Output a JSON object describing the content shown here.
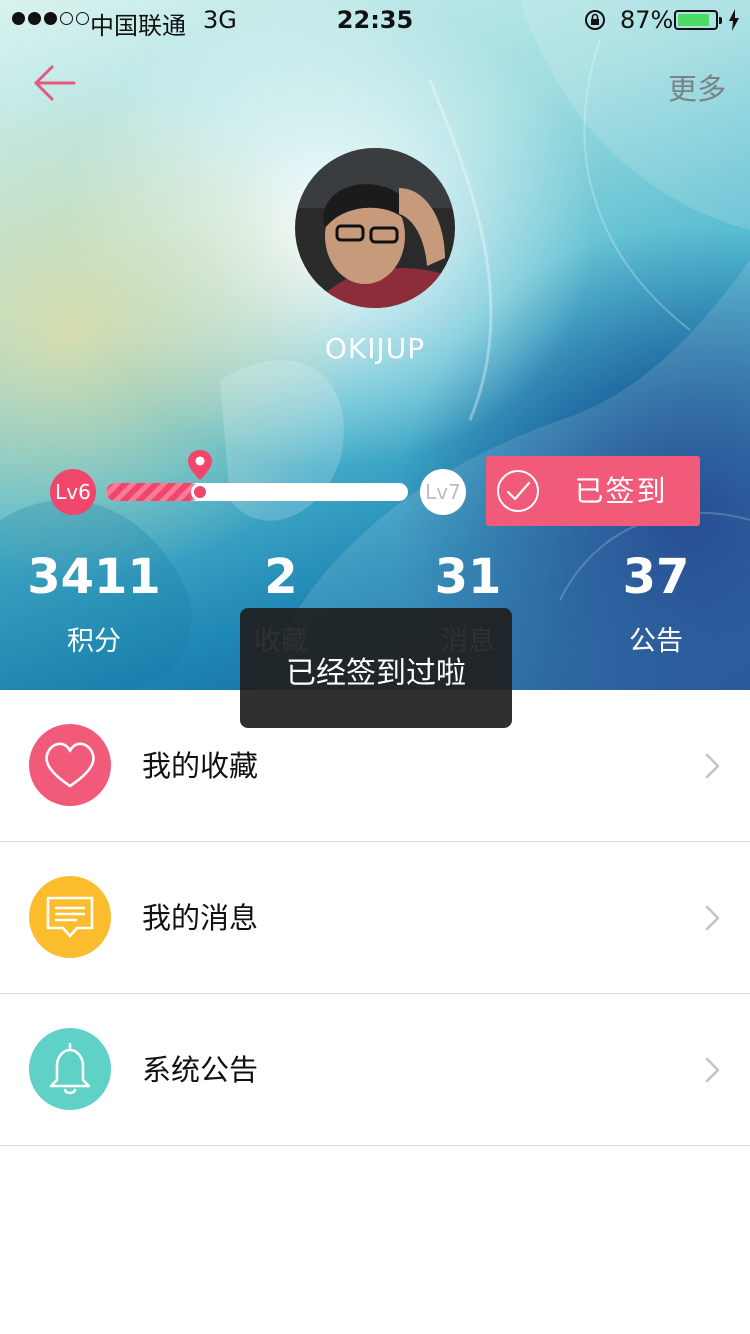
{
  "status_bar": {
    "carrier": "中国联通",
    "network": "3G",
    "time": "22:35",
    "battery_percent": "87%",
    "battery_level": 0.87,
    "signal_bars": 3
  },
  "nav": {
    "back_icon": "arrow-left-icon",
    "more_label": "更多"
  },
  "profile": {
    "username": "OKIJUP"
  },
  "level": {
    "current": "Lv6",
    "next": "Lv7",
    "progress": 0.31
  },
  "checkin": {
    "label": "已签到",
    "icon": "check-circle-icon"
  },
  "stats": [
    {
      "value": "3411",
      "label": "积分"
    },
    {
      "value": "2",
      "label": "收藏"
    },
    {
      "value": "31",
      "label": "消息"
    },
    {
      "value": "37",
      "label": "公告"
    }
  ],
  "menu": [
    {
      "label": "我的收藏",
      "icon": "heart-icon",
      "color": "#f25a7a"
    },
    {
      "label": "我的消息",
      "icon": "message-icon",
      "color": "#fbbd2d"
    },
    {
      "label": "系统公告",
      "icon": "bell-icon",
      "color": "#5fd1c6"
    }
  ],
  "toast": {
    "message": "已经签到过啦"
  },
  "colors": {
    "accent": "#f0466c",
    "checkin_bg": "#f25a7a"
  }
}
